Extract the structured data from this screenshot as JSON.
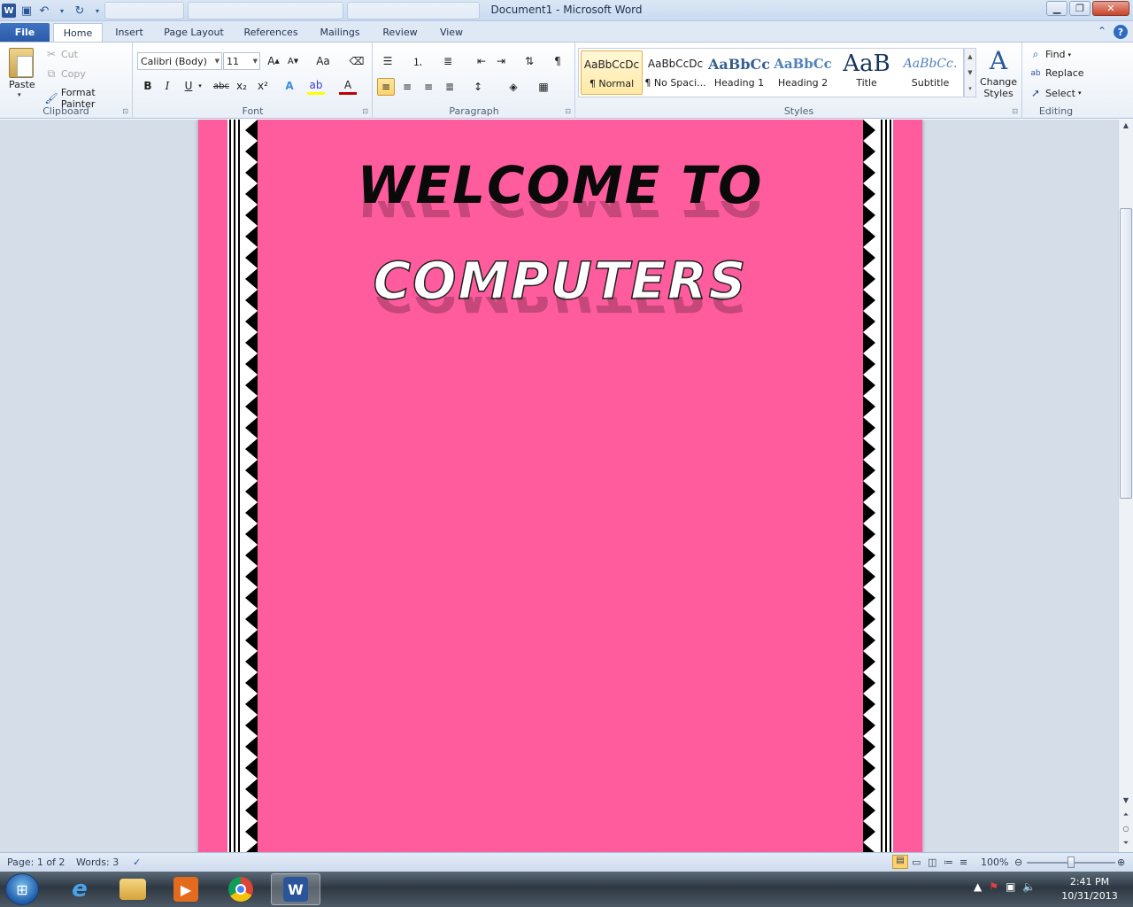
{
  "window": {
    "title": "Document1  -  Microsoft Word"
  },
  "quick_access": {
    "icons": [
      "word-logo-icon",
      "save-icon",
      "undo-icon",
      "redo-icon",
      "customize-icon"
    ]
  },
  "tabs": [
    "File",
    "Home",
    "Insert",
    "Page Layout",
    "References",
    "Mailings",
    "Review",
    "View"
  ],
  "clipboard": {
    "paste": "Paste",
    "cut": "Cut",
    "copy": "Copy",
    "format_painter": "Format Painter",
    "label": "Clipboard"
  },
  "font": {
    "name": "Calibri (Body)",
    "size": "11",
    "label": "Font",
    "bold": "B",
    "italic": "I",
    "underline": "U",
    "strike": "abc",
    "sub": "x₂",
    "sup": "x²",
    "case": "Aa"
  },
  "paragraph": {
    "label": "Paragraph"
  },
  "styles": {
    "label": "Styles",
    "items": [
      {
        "sample": "AaBbCcDc",
        "name": "¶ Normal"
      },
      {
        "sample": "AaBbCcDc",
        "name": "¶ No Spaci..."
      },
      {
        "sample": "AaBbCc",
        "name": "Heading 1"
      },
      {
        "sample": "AaBbCc",
        "name": "Heading 2"
      },
      {
        "sample": "AaB",
        "name": "Title"
      },
      {
        "sample": "AaBbCc.",
        "name": "Subtitle"
      }
    ],
    "change_styles": "Change Styles"
  },
  "editing": {
    "find": "Find",
    "replace": "Replace",
    "select": "Select",
    "label": "Editing"
  },
  "document": {
    "line1": "WELCOME TO",
    "line2": "COMPUTERS",
    "page_color": "#ff5c9e"
  },
  "status": {
    "page": "Page: 1 of 2",
    "words": "Words: 3",
    "zoom": "100%"
  },
  "taskbar": {
    "time": "2:41 PM",
    "date": "10/31/2013"
  }
}
